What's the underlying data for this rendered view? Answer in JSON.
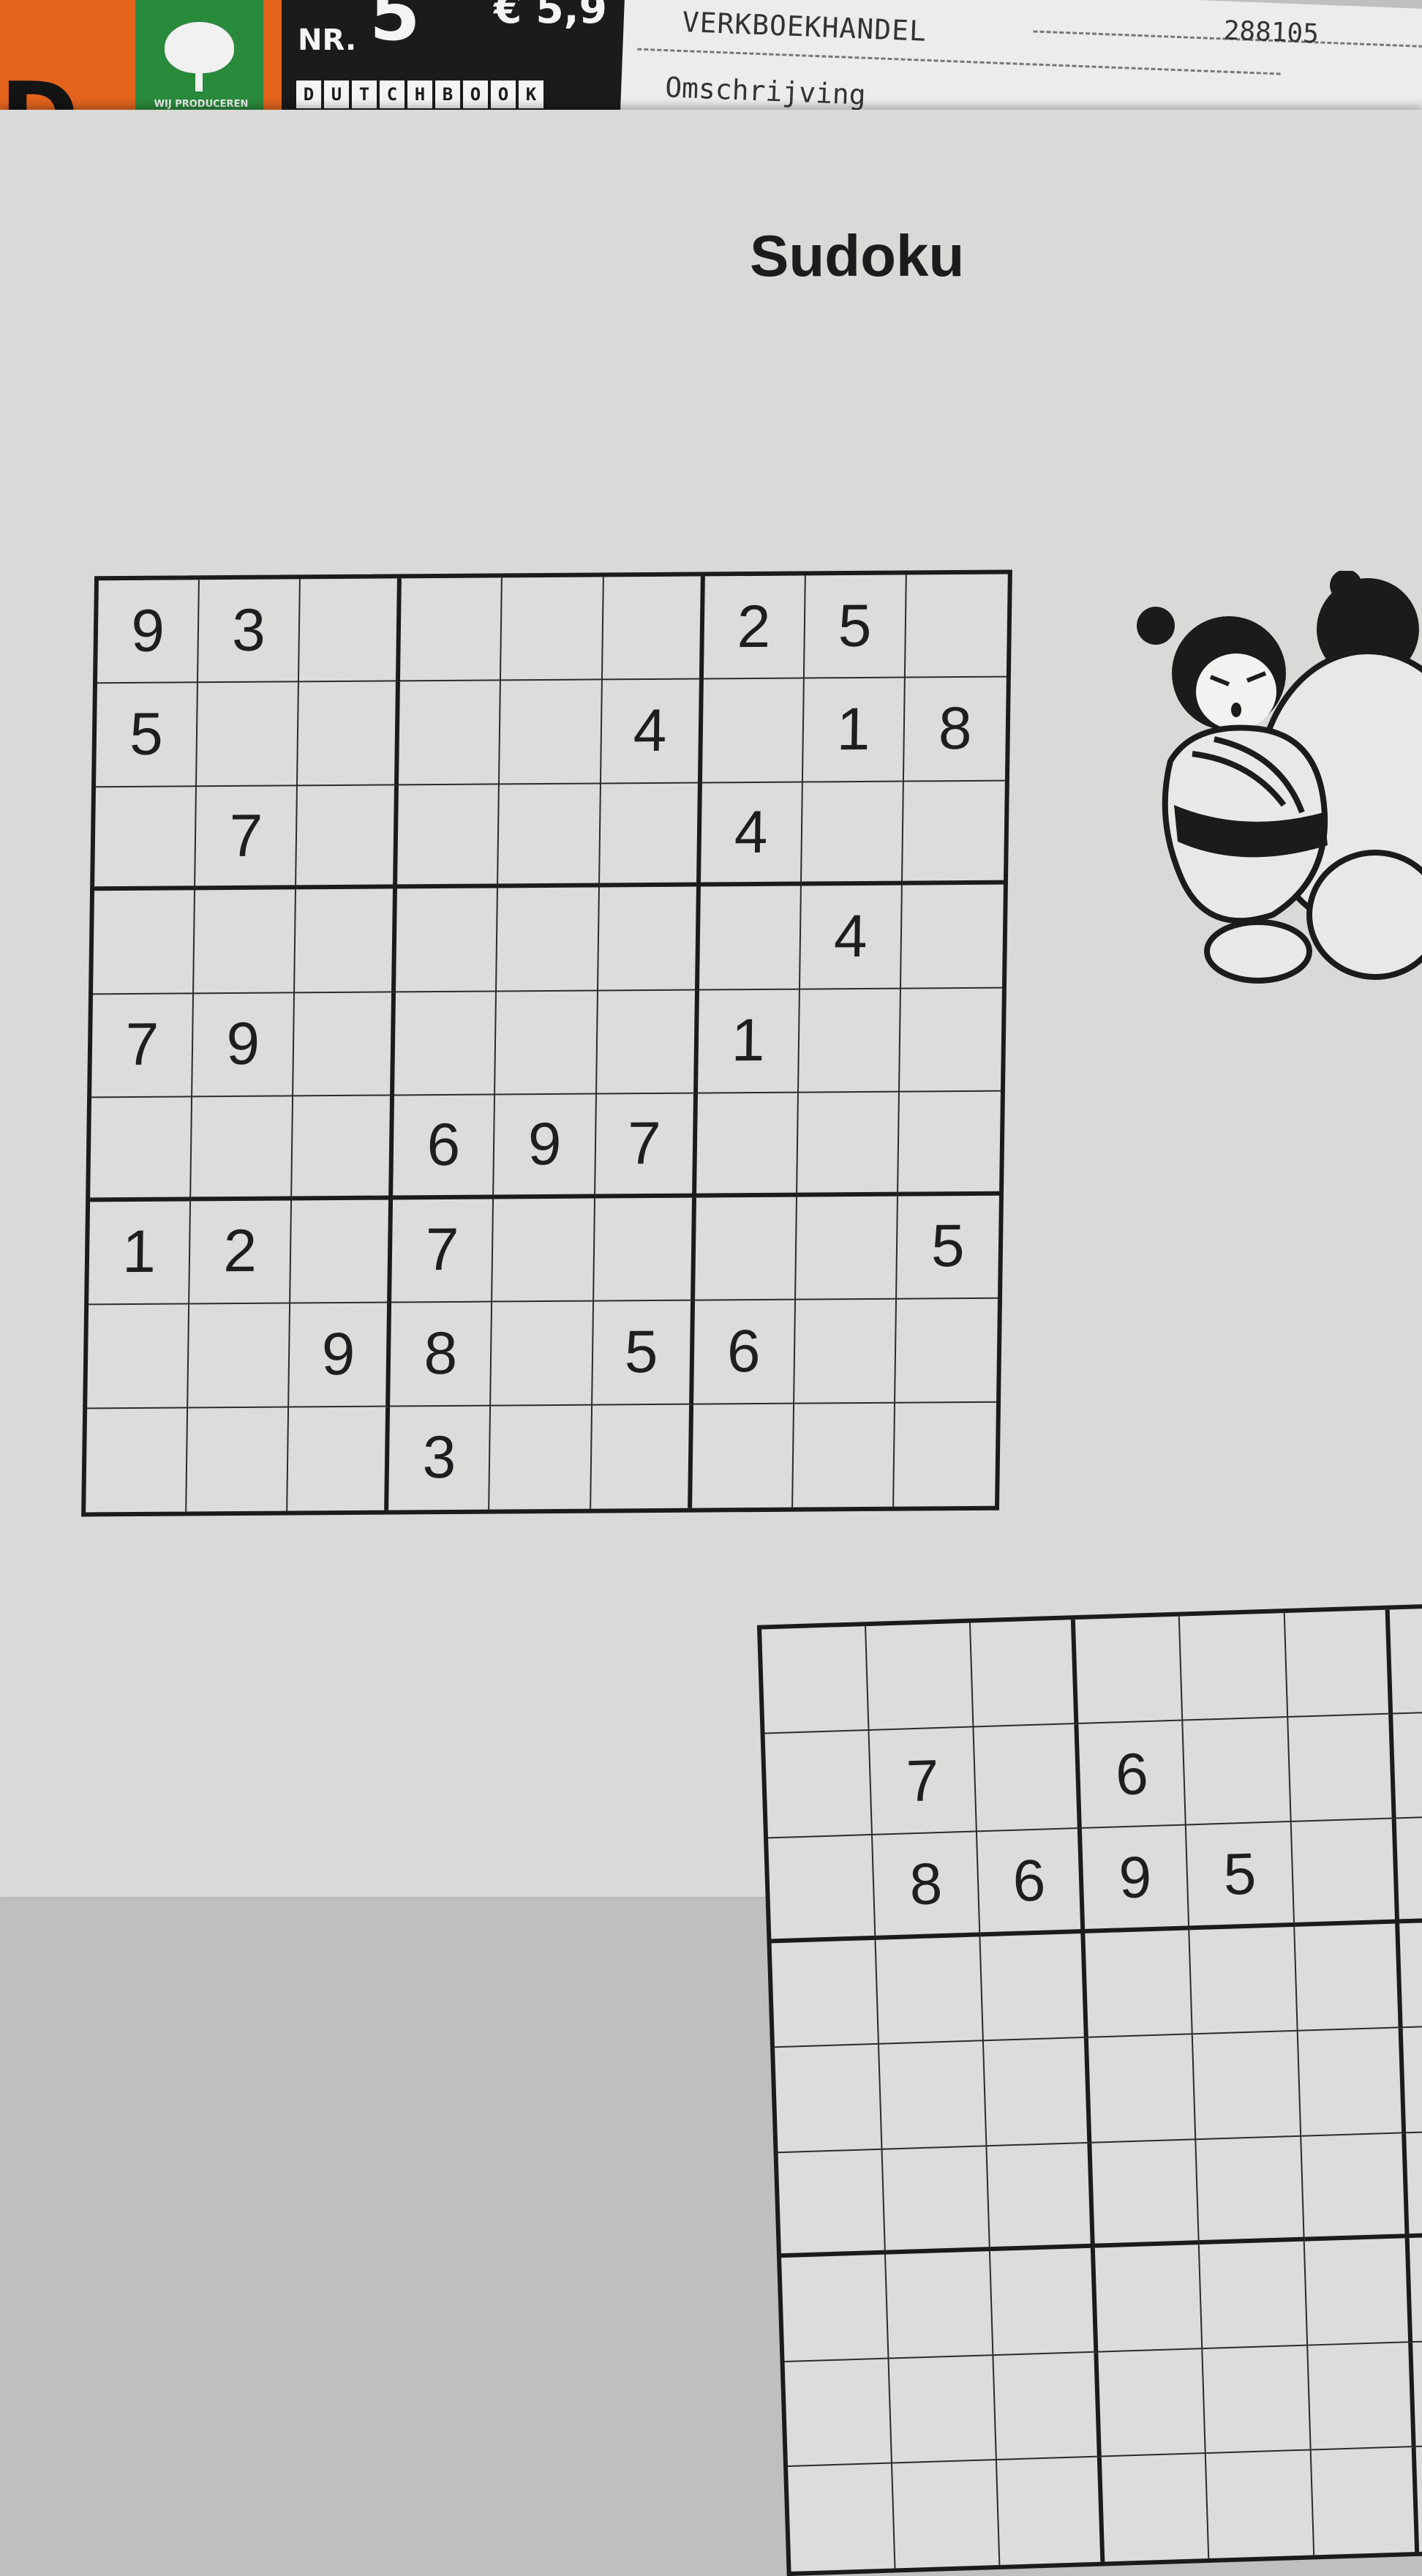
{
  "magazine": {
    "big_letter": "D",
    "slogan": "WIJ PRODUCEREN GROEN",
    "issue_label": "NR.",
    "issue_number": "5",
    "price": "€ 5,9",
    "brand_letters": [
      "D",
      "U",
      "T",
      "C",
      "H",
      "B",
      "O",
      "O",
      "K"
    ],
    "colors": {
      "orange": "#e4641e",
      "green": "#2a8a3c",
      "black": "#1b1b1b"
    }
  },
  "receipt": {
    "shop": "VERKBOEKHANDEL",
    "description": "Omschrijving",
    "number": "288105"
  },
  "page": {
    "title": "Sudoku"
  },
  "main_sudoku": {
    "rows": [
      [
        "9",
        "3",
        "",
        "",
        "",
        "",
        "2",
        "5",
        ""
      ],
      [
        "5",
        "",
        "",
        "",
        "",
        "4",
        "",
        "1",
        "8"
      ],
      [
        "",
        "7",
        "",
        "",
        "",
        "",
        "4",
        "",
        ""
      ],
      [
        "",
        "",
        "",
        "",
        "",
        "",
        "",
        "4",
        ""
      ],
      [
        "7",
        "9",
        "",
        "",
        "",
        "",
        "1",
        "",
        ""
      ],
      [
        "",
        "",
        "",
        "6",
        "9",
        "7",
        "",
        "",
        ""
      ],
      [
        "1",
        "2",
        "",
        "7",
        "",
        "",
        "",
        "",
        "5"
      ],
      [
        "",
        "",
        "9",
        "8",
        "",
        "5",
        "6",
        "",
        ""
      ],
      [
        "",
        "",
        "",
        "3",
        "",
        "",
        "",
        "",
        ""
      ]
    ]
  },
  "second_sudoku": {
    "rows": [
      [
        "",
        "",
        "",
        "",
        "",
        ""
      ],
      [
        "",
        "7",
        "",
        "6",
        "",
        ""
      ],
      [
        "",
        "8",
        "6",
        "9",
        "5",
        ""
      ]
    ]
  },
  "illustration": {
    "subject": "sumo-wrestlers-icon"
  }
}
